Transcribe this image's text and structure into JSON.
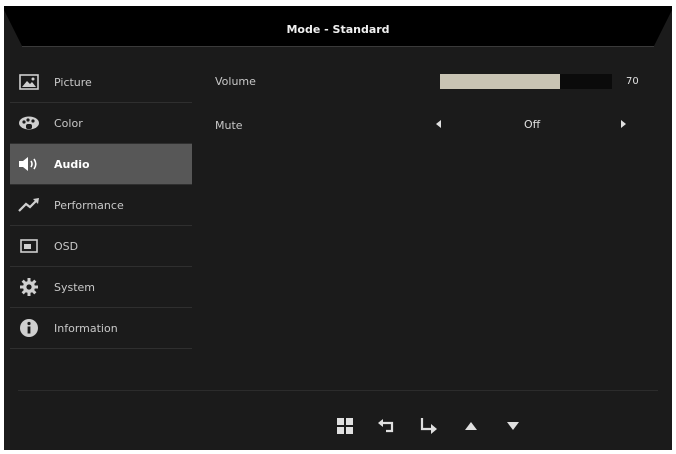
{
  "header": {
    "title": "Mode - Standard"
  },
  "sidebar": {
    "items": [
      {
        "label": "Picture",
        "icon": "picture-icon",
        "active": false
      },
      {
        "label": "Color",
        "icon": "palette-icon",
        "active": false
      },
      {
        "label": "Audio",
        "icon": "speaker-icon",
        "active": true
      },
      {
        "label": "Performance",
        "icon": "trend-up-icon",
        "active": false
      },
      {
        "label": "OSD",
        "icon": "osd-screen-icon",
        "active": false
      },
      {
        "label": "System",
        "icon": "gear-icon",
        "active": false
      },
      {
        "label": "Information",
        "icon": "info-icon",
        "active": false
      }
    ]
  },
  "audio": {
    "volume_label": "Volume",
    "volume_value": "70",
    "volume_level": 70,
    "volume_max": 100,
    "mute_label": "Mute",
    "mute_value": "Off"
  },
  "footer": {
    "buttons": [
      "menu-grid-icon",
      "back-icon",
      "enter-icon",
      "up-arrow-icon",
      "down-arrow-icon"
    ]
  },
  "colors": {
    "background": "#1b1b1b",
    "active_item": "#575757",
    "bar_fill": "#c9c4b4",
    "text": "#c8c8c8"
  }
}
